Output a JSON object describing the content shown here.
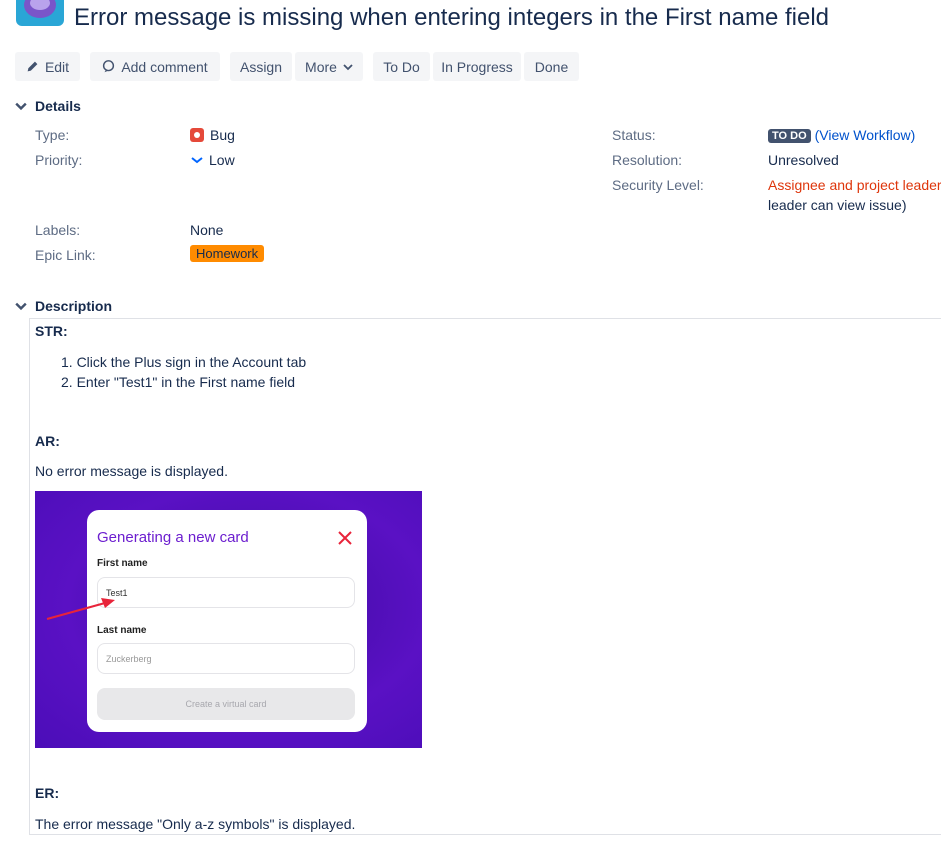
{
  "issue": {
    "title": "Error message is missing when entering integers in the First name field"
  },
  "toolbar": {
    "edit": "Edit",
    "add_comment": "Add comment",
    "assign": "Assign",
    "more": "More",
    "todo": "To Do",
    "in_progress": "In Progress",
    "done": "Done"
  },
  "details": {
    "heading": "Details",
    "type_label": "Type:",
    "type_value": "Bug",
    "priority_label": "Priority:",
    "priority_value": "Low",
    "labels_label": "Labels:",
    "labels_value": "None",
    "epic_label": "Epic Link:",
    "epic_value": "Homework",
    "status_label": "Status:",
    "status_value": "TO DO",
    "view_workflow": "(View Workflow)",
    "resolution_label": "Resolution:",
    "resolution_value": "Unresolved",
    "security_label": "Security Level:",
    "security_value": "Assignee and project leader",
    "security_note": "leader can view issue)"
  },
  "description": {
    "heading": "Description",
    "str_heading": "STR:",
    "steps": [
      "1. Click the Plus sign in the Account tab",
      "2. Enter \"Test1\" in the First name field"
    ],
    "ar_heading": "AR:",
    "ar_text": "No error message is displayed.",
    "er_heading": "ER:",
    "er_text": "The error message \"Only a-z symbols\" is displayed."
  },
  "screenshot": {
    "card_title": "Generating a new card",
    "first_name_label": "First name",
    "first_name_value": "Test1",
    "last_name_label": "Last name",
    "last_name_placeholder": "Zuckerberg",
    "create_button": "Create a virtual card"
  },
  "colors": {
    "bug": "#e5493a",
    "epic": "#ff8b00",
    "status": "#42526e",
    "link": "#0052cc",
    "security": "#de350b",
    "card_accent": "#6c1ecf"
  }
}
